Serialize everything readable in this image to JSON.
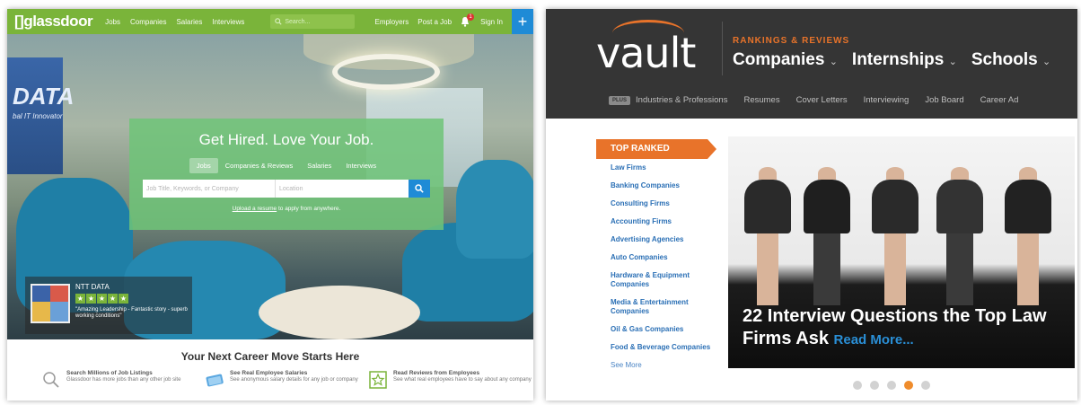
{
  "glassdoor": {
    "logo": "glassdoor",
    "nav": [
      "Jobs",
      "Companies",
      "Salaries",
      "Interviews"
    ],
    "search_placeholder": "Search...",
    "right_nav": [
      "Employers",
      "Post a Job",
      "Sign In"
    ],
    "notification_count": "1",
    "plus": "+",
    "wall_sign": "DATA",
    "wall_sign_sub": "bal IT Innovator",
    "hero_title": "Get Hired. Love Your Job.",
    "tabs": [
      "Jobs",
      "Companies & Reviews",
      "Salaries",
      "Interviews"
    ],
    "keyword_placeholder": "Job Title, Keywords, or Company",
    "location_placeholder": "Location",
    "upload_link": "Upload a resume",
    "upload_rest": " to apply from anywhere.",
    "card": {
      "company": "NTT DATA",
      "rating_stars": 5,
      "quote": "\"Amazing Leadership - Fantastic story - superb working conditions\""
    },
    "footer_title": "Your Next Career Move Starts Here",
    "features": [
      {
        "icon": "magnifier-icon",
        "title": "Search Millions of Job Listings",
        "text": "Glassdoor has more jobs than any other job site"
      },
      {
        "icon": "money-icon",
        "title": "See Real Employee Salaries",
        "text": "See anonymous salary details for any job or company"
      },
      {
        "icon": "star-review-icon",
        "title": "Read Reviews from Employees",
        "text": "See what real employees have to say about any company"
      }
    ],
    "brand_green": "#7ab43a",
    "accent_blue": "#1f8bd6"
  },
  "vault": {
    "logo": "vault",
    "eyebrow": "RANKINGS & REVIEWS",
    "menu": [
      "Companies",
      "Internships",
      "Schools"
    ],
    "plus_badge": "PLUS",
    "sub_nav": [
      "Industries & Professions",
      "Resumes",
      "Cover Letters",
      "Interviewing",
      "Job Board",
      "Career Ad"
    ],
    "ribbon": "TOP RANKED",
    "ranked_list": [
      "Law Firms",
      "Banking Companies",
      "Consulting Firms",
      "Accounting Firms",
      "Advertising Agencies",
      "Auto Companies",
      "Hardware & Equipment Companies",
      "Media & Entertainment Companies",
      "Oil & Gas Companies",
      "Food & Beverage Companies"
    ],
    "see_more": "See More",
    "headline": "22 Interview Questions the Top Law Firms Ask",
    "read_more": "Read More...",
    "carousel": {
      "count": 5,
      "active_index": 3
    },
    "accent_orange": "#e8732a"
  }
}
